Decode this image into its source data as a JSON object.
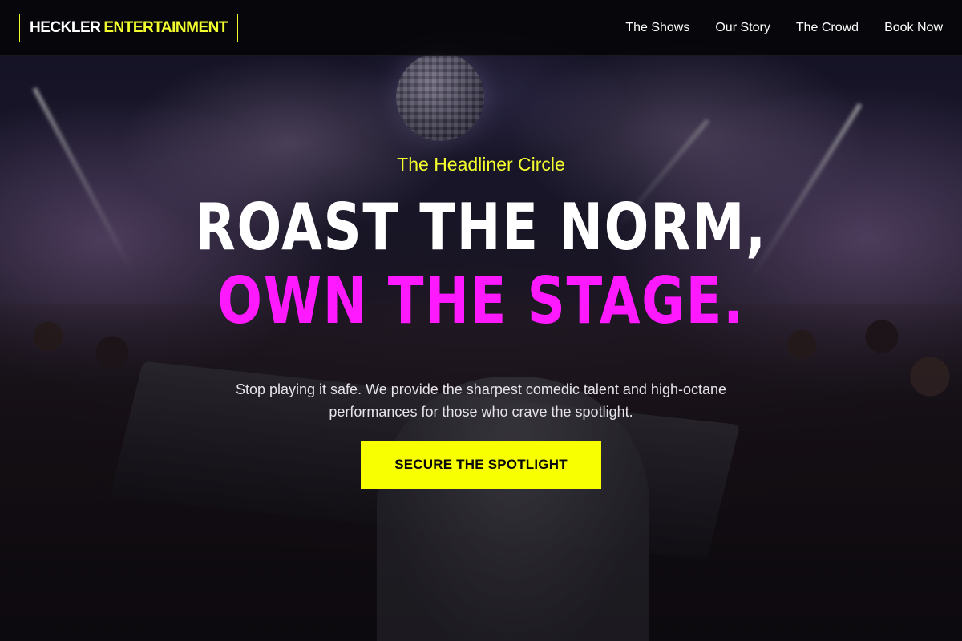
{
  "brand": {
    "name_part1": "HECKLER",
    "name_part2": "ENTERTAINMENT"
  },
  "nav": {
    "items": [
      {
        "label": "The Shows"
      },
      {
        "label": "Our Story"
      },
      {
        "label": "The Crowd"
      },
      {
        "label": "Book Now"
      }
    ]
  },
  "hero": {
    "eyebrow": "The Headliner Circle",
    "headline_line1": "ROAST THE NORM,",
    "headline_line2": "OWN THE STAGE.",
    "subtext": "Stop playing it safe. We provide the sharpest comedic talent and high-octane performances for those who crave the spotlight.",
    "cta_label": "SECURE THE SPOTLIGHT"
  },
  "colors": {
    "accent_yellow": "#f4ff2e",
    "accent_magenta": "#ff19ff",
    "header_bg": "#060608"
  }
}
